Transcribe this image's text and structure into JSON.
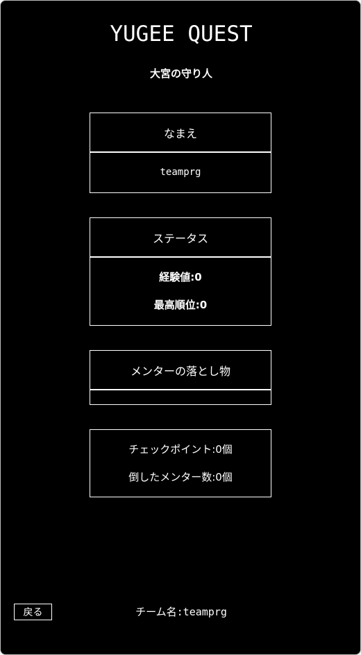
{
  "header": {
    "title": "YUGEE QUEST",
    "subtitle": "大宮の守り人"
  },
  "name_panel": {
    "label": "なまえ",
    "value": "teamprg"
  },
  "status_panel": {
    "label": "ステータス",
    "experience": "経験値:0",
    "best_rank": "最高順位:0"
  },
  "items_panel": {
    "label": "メンターの落とし物",
    "items": []
  },
  "progress_panel": {
    "checkpoints": "チェックポイント:0個",
    "mentors_defeated": "倒したメンター数:0個"
  },
  "footer": {
    "back_label": "戻る",
    "team_name": "チーム名:teamprg"
  },
  "colors": {
    "background": "#000000",
    "foreground": "#ffffff"
  }
}
